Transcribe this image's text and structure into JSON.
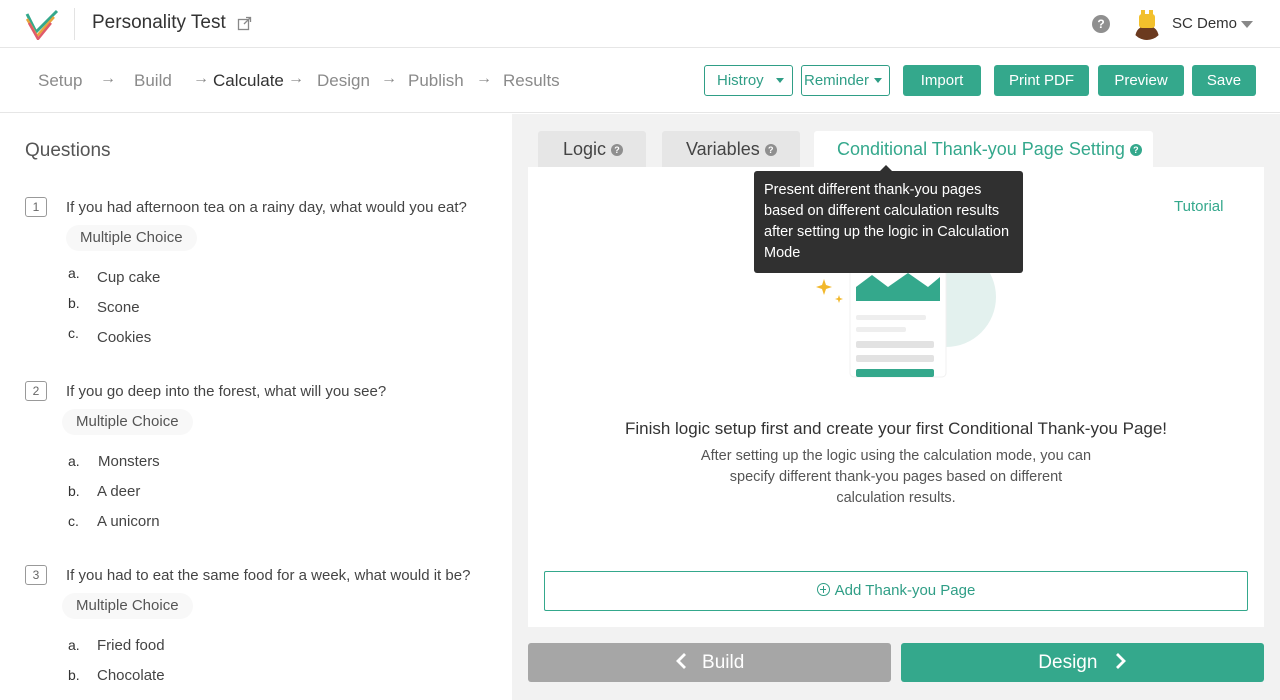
{
  "app": {
    "title": "Personality Test",
    "user_name": "SC Demo"
  },
  "steps": [
    "Setup",
    "Build",
    "Calculate",
    "Design",
    "Publish",
    "Results"
  ],
  "active_step": "Calculate",
  "toolbar": {
    "history_label": "Histroy",
    "reminder_label": "Reminder",
    "import_label": "Import",
    "print_label": "Print PDF",
    "preview_label": "Preview",
    "save_label": "Save"
  },
  "questions_panel": {
    "title": "Questions",
    "questions": [
      {
        "number": "1",
        "text": "If you had afternoon tea on a rainy day, what would you eat?",
        "type": "Multiple Choice",
        "options": [
          {
            "letter": "a.",
            "text": "Cup cake"
          },
          {
            "letter": "b.",
            "text": "Scone"
          },
          {
            "letter": "c.",
            "text": "Cookies"
          }
        ]
      },
      {
        "number": "2",
        "text": "If you go deep into the forest, what will you see?",
        "type": "Multiple Choice",
        "options": [
          {
            "letter": "a.",
            "text": "Monsters"
          },
          {
            "letter": "b.",
            "text": "A deer"
          },
          {
            "letter": "c.",
            "text": "A unicorn"
          }
        ]
      },
      {
        "number": "3",
        "text": "If you had to eat the same food for a week, what would it be?",
        "type": "Multiple Choice",
        "options": [
          {
            "letter": "a.",
            "text": "Fried food"
          },
          {
            "letter": "b.",
            "text": "Chocolate"
          }
        ]
      }
    ]
  },
  "tabs": [
    {
      "label": "Logic",
      "active": false
    },
    {
      "label": "Variables",
      "active": false
    },
    {
      "label": "Conditional Thank-you Page Setting",
      "active": true
    }
  ],
  "tooltip": {
    "text": "Present different thank-you pages based on different calculation results after setting up the logic in Calculation Mode"
  },
  "content": {
    "tutorial_link": "Tutorial",
    "heading": "Finish logic setup first and create your first Conditional Thank-you Page!",
    "description": "After setting up the logic using the calculation mode, you can specify different thank-you pages based on different calculation results.",
    "add_button_label": "Add Thank-you Page"
  },
  "footer_nav": {
    "back_label": "Build",
    "next_label": "Design"
  },
  "colors": {
    "accent": "#34a88c",
    "accent_dark": "#2f9e86",
    "tooltip_bg": "#303030",
    "back_button": "#a6a6a6",
    "panel_bg": "#f2f2f2"
  },
  "icons": [
    "app-logo-icon",
    "external-link-icon",
    "help-icon",
    "avatar",
    "caret-down-icon",
    "help-circle-icon",
    "plus-circle-icon",
    "chevron-left-icon",
    "chevron-right-icon"
  ]
}
